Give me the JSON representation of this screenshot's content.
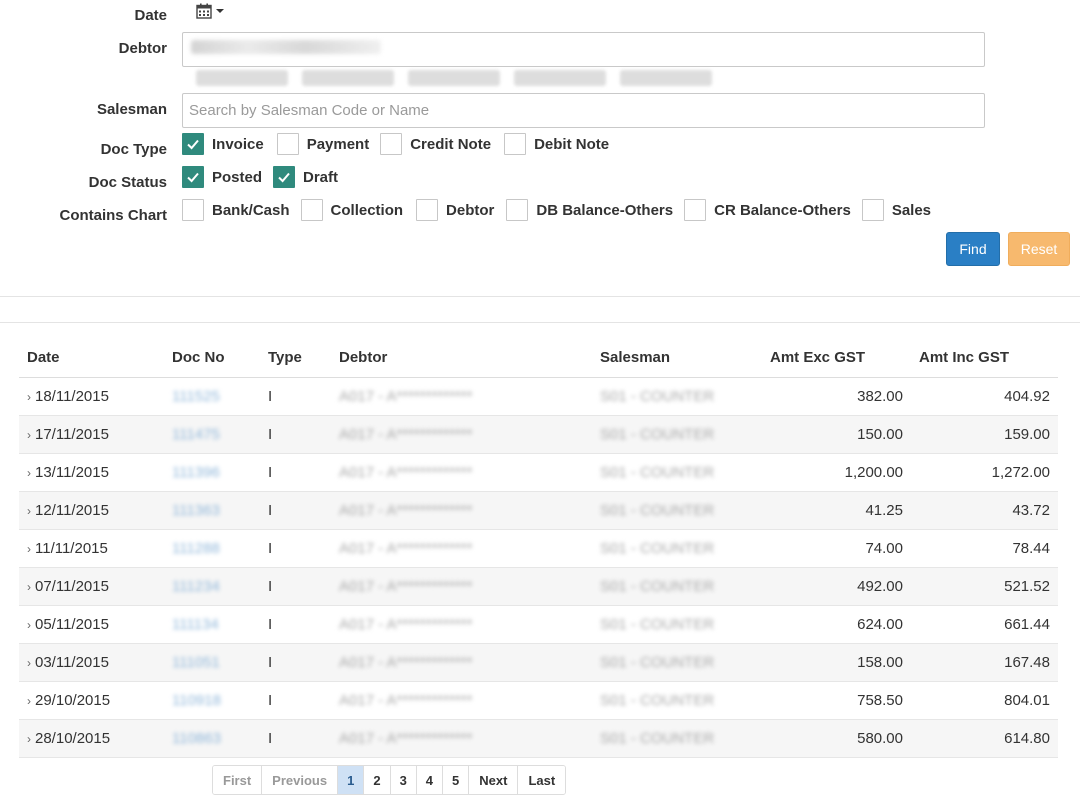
{
  "filters": {
    "date_label": "Date",
    "debtor_label": "Debtor",
    "debtor_value": "A017 - A*************",
    "debtor_tags": [
      "A01XXXX",
      "A01XXXX",
      "A01XXXX",
      "A01XXXX",
      "A01XXXX"
    ],
    "salesman_label": "Salesman",
    "salesman_placeholder": "Search by Salesman Code or Name",
    "doc_type_label": "Doc Type",
    "doc_types": [
      {
        "label": "Invoice",
        "checked": true
      },
      {
        "label": "Payment",
        "checked": false
      },
      {
        "label": "Credit Note",
        "checked": false
      },
      {
        "label": "Debit Note",
        "checked": false
      }
    ],
    "doc_status_label": "Doc Status",
    "doc_statuses": [
      {
        "label": "Posted",
        "checked": true
      },
      {
        "label": "Draft",
        "checked": true
      }
    ],
    "contains_chart_label": "Contains Chart",
    "charts": [
      {
        "label": "Bank/Cash",
        "checked": false
      },
      {
        "label": "Collection",
        "checked": false
      },
      {
        "label": "Debtor",
        "checked": false
      },
      {
        "label": "DB Balance-Others",
        "checked": false
      },
      {
        "label": "CR Balance-Others",
        "checked": false
      },
      {
        "label": "Sales",
        "checked": false
      }
    ],
    "find_label": "Find",
    "reset_label": "Reset"
  },
  "table": {
    "columns": [
      "Date",
      "Doc No",
      "Type",
      "Debtor",
      "Salesman",
      "Amt Exc GST",
      "Amt Inc GST"
    ],
    "rows": [
      {
        "date": "18/11/2015",
        "doc_no": "111525",
        "type": "I",
        "debtor": "A017 - A*************",
        "salesman": "S01 - COUNTER",
        "exc": "382.00",
        "inc": "404.92"
      },
      {
        "date": "17/11/2015",
        "doc_no": "111475",
        "type": "I",
        "debtor": "A017 - A*************",
        "salesman": "S01 - COUNTER",
        "exc": "150.00",
        "inc": "159.00"
      },
      {
        "date": "13/11/2015",
        "doc_no": "111396",
        "type": "I",
        "debtor": "A017 - A*************",
        "salesman": "S01 - COUNTER",
        "exc": "1,200.00",
        "inc": "1,272.00"
      },
      {
        "date": "12/11/2015",
        "doc_no": "111363",
        "type": "I",
        "debtor": "A017 - A*************",
        "salesman": "S01 - COUNTER",
        "exc": "41.25",
        "inc": "43.72"
      },
      {
        "date": "11/11/2015",
        "doc_no": "111288",
        "type": "I",
        "debtor": "A017 - A*************",
        "salesman": "S01 - COUNTER",
        "exc": "74.00",
        "inc": "78.44"
      },
      {
        "date": "07/11/2015",
        "doc_no": "111234",
        "type": "I",
        "debtor": "A017 - A*************",
        "salesman": "S01 - COUNTER",
        "exc": "492.00",
        "inc": "521.52"
      },
      {
        "date": "05/11/2015",
        "doc_no": "111134",
        "type": "I",
        "debtor": "A017 - A*************",
        "salesman": "S01 - COUNTER",
        "exc": "624.00",
        "inc": "661.44"
      },
      {
        "date": "03/11/2015",
        "doc_no": "111051",
        "type": "I",
        "debtor": "A017 - A*************",
        "salesman": "S01 - COUNTER",
        "exc": "158.00",
        "inc": "167.48"
      },
      {
        "date": "29/10/2015",
        "doc_no": "110918",
        "type": "I",
        "debtor": "A017 - A*************",
        "salesman": "S01 - COUNTER",
        "exc": "758.50",
        "inc": "804.01"
      },
      {
        "date": "28/10/2015",
        "doc_no": "110863",
        "type": "I",
        "debtor": "A017 - A*************",
        "salesman": "S01 - COUNTER",
        "exc": "580.00",
        "inc": "614.80"
      }
    ]
  },
  "pagination": {
    "first": "First",
    "previous": "Previous",
    "pages": [
      "1",
      "2",
      "3",
      "4",
      "5"
    ],
    "current_page": "1",
    "next": "Next",
    "last": "Last"
  },
  "colors": {
    "checkbox_checked": "#2f8a7d",
    "find_button": "#2a7fc5",
    "reset_button": "#f7b96e",
    "active_page": "#cfe1f5"
  }
}
